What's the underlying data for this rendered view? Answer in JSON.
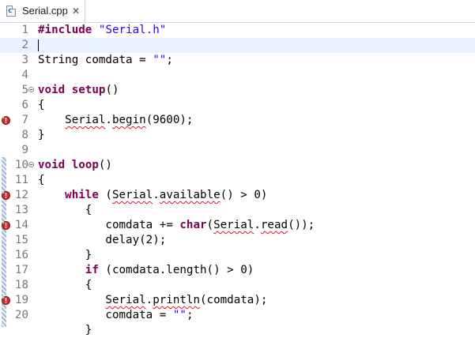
{
  "tab": {
    "title": "Serial.cpp",
    "close": "✕",
    "icon": "c-source-file-icon"
  },
  "colors": {
    "keyword": "#7f0055",
    "string": "#2a00ff",
    "current_line": "#e8f2fe",
    "error": "#d8142a"
  },
  "lines": [
    {
      "n": "1",
      "fold": false,
      "warn": false,
      "parts": [
        {
          "t": "#include ",
          "c": "kw"
        },
        {
          "t": "\"Serial.h\"",
          "c": "str"
        }
      ]
    },
    {
      "n": "2",
      "fold": false,
      "warn": false,
      "current": true,
      "parts": []
    },
    {
      "n": "3",
      "fold": false,
      "warn": false,
      "parts": [
        {
          "t": "String comdata = ",
          "c": ""
        },
        {
          "t": "\"\"",
          "c": "str"
        },
        {
          "t": ";",
          "c": ""
        }
      ]
    },
    {
      "n": "4",
      "fold": false,
      "warn": false,
      "parts": []
    },
    {
      "n": "5",
      "fold": true,
      "warn": false,
      "parts": [
        {
          "t": "void",
          "c": "kw"
        },
        {
          "t": " ",
          "c": ""
        },
        {
          "t": "setup",
          "c": "kw"
        },
        {
          "t": "()",
          "c": ""
        }
      ]
    },
    {
      "n": "6",
      "fold": false,
      "warn": false,
      "parts": [
        {
          "t": "{",
          "c": ""
        }
      ]
    },
    {
      "n": "7",
      "fold": false,
      "warn": true,
      "parts": [
        {
          "t": "    ",
          "c": ""
        },
        {
          "t": "Serial",
          "c": "sq"
        },
        {
          "t": ".",
          "c": ""
        },
        {
          "t": "begin",
          "c": "sq"
        },
        {
          "t": "(9600);",
          "c": ""
        }
      ]
    },
    {
      "n": "8",
      "fold": false,
      "warn": false,
      "parts": [
        {
          "t": "}",
          "c": ""
        }
      ]
    },
    {
      "n": "9",
      "fold": false,
      "warn": false,
      "parts": []
    },
    {
      "n": "10",
      "fold": true,
      "warn": false,
      "parts": [
        {
          "t": "void",
          "c": "kw"
        },
        {
          "t": " ",
          "c": ""
        },
        {
          "t": "loop",
          "c": "kw"
        },
        {
          "t": "()",
          "c": ""
        }
      ]
    },
    {
      "n": "11",
      "fold": false,
      "warn": false,
      "parts": [
        {
          "t": "{",
          "c": ""
        }
      ]
    },
    {
      "n": "12",
      "fold": false,
      "warn": true,
      "parts": [
        {
          "t": "    ",
          "c": ""
        },
        {
          "t": "while",
          "c": "kw"
        },
        {
          "t": " (",
          "c": ""
        },
        {
          "t": "Serial",
          "c": "sq"
        },
        {
          "t": ".",
          "c": ""
        },
        {
          "t": "available",
          "c": "sq"
        },
        {
          "t": "() > 0)",
          "c": ""
        }
      ]
    },
    {
      "n": "13",
      "fold": false,
      "warn": false,
      "parts": [
        {
          "t": "       {",
          "c": ""
        }
      ]
    },
    {
      "n": "14",
      "fold": false,
      "warn": true,
      "parts": [
        {
          "t": "          comdata += ",
          "c": ""
        },
        {
          "t": "char",
          "c": "kw"
        },
        {
          "t": "(",
          "c": ""
        },
        {
          "t": "Serial",
          "c": "sq"
        },
        {
          "t": ".",
          "c": ""
        },
        {
          "t": "read",
          "c": "sq"
        },
        {
          "t": "());",
          "c": ""
        }
      ]
    },
    {
      "n": "15",
      "fold": false,
      "warn": false,
      "parts": [
        {
          "t": "          delay(2);",
          "c": ""
        }
      ]
    },
    {
      "n": "16",
      "fold": false,
      "warn": false,
      "parts": [
        {
          "t": "       }",
          "c": ""
        }
      ]
    },
    {
      "n": "17",
      "fold": false,
      "warn": false,
      "parts": [
        {
          "t": "       ",
          "c": ""
        },
        {
          "t": "if",
          "c": "kw"
        },
        {
          "t": " (comdata.length() > 0)",
          "c": ""
        }
      ]
    },
    {
      "n": "18",
      "fold": false,
      "warn": false,
      "parts": [
        {
          "t": "       {",
          "c": ""
        }
      ]
    },
    {
      "n": "19",
      "fold": false,
      "warn": true,
      "parts": [
        {
          "t": "          ",
          "c": ""
        },
        {
          "t": "Serial",
          "c": "sq"
        },
        {
          "t": ".",
          "c": ""
        },
        {
          "t": "println",
          "c": "sq"
        },
        {
          "t": "(comdata);",
          "c": ""
        }
      ]
    },
    {
      "n": "20",
      "fold": false,
      "warn": false,
      "parts": [
        {
          "t": "          comdata = ",
          "c": ""
        },
        {
          "t": "\"\"",
          "c": "str"
        },
        {
          "t": ";",
          "c": ""
        }
      ]
    },
    {
      "n": "",
      "fold": false,
      "warn": false,
      "parts": [
        {
          "t": "       }",
          "c": ""
        }
      ]
    }
  ]
}
